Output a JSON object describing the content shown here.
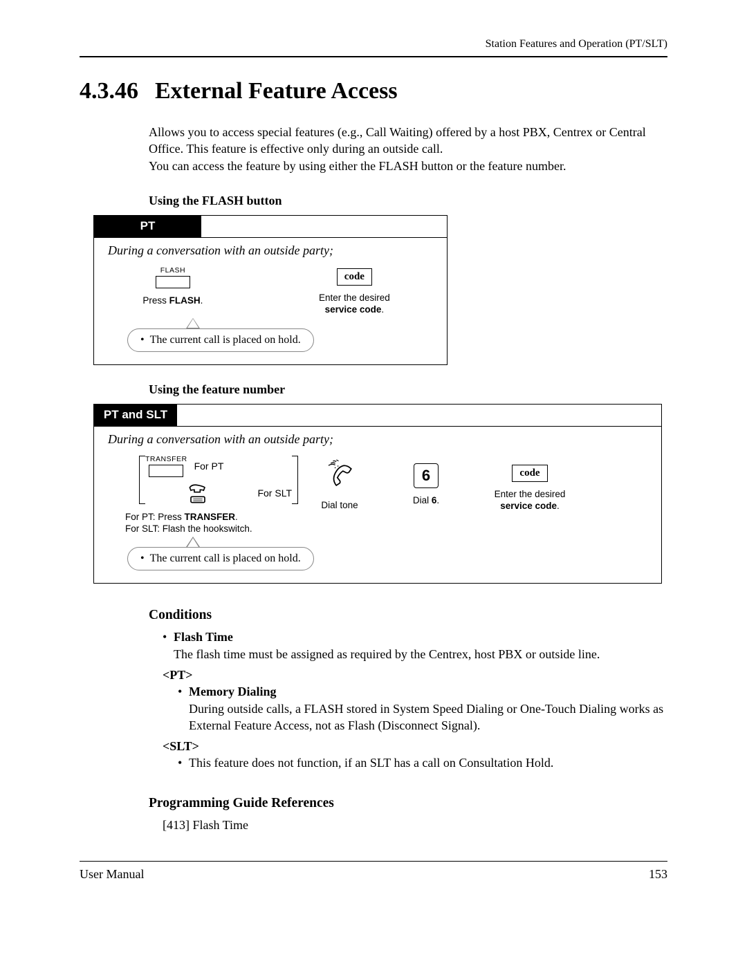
{
  "running_head": "Station Features and Operation (PT/SLT)",
  "section_number": "4.3.46",
  "section_title": "External Feature Access",
  "intro_p1": "Allows you to access special features (e.g., Call Waiting) offered by a host PBX, Centrex or Central Office. This feature is effective only during an outside call.",
  "intro_p2": "You can access the feature by using either the FLASH button or the feature number.",
  "proc1": {
    "heading": "Using the FLASH button",
    "tab": "PT",
    "caption": "During a conversation with an outside party;",
    "flash_label": "FLASH",
    "step1_text_a": "Press ",
    "step1_text_b": "FLASH",
    "step1_text_c": ".",
    "code_label": "code",
    "step2_text_a": "Enter the desired",
    "step2_text_b": "service code",
    "step2_text_c": ".",
    "note": "The current call is placed on hold."
  },
  "proc2": {
    "heading": "Using the feature number",
    "tab": "PT and SLT",
    "caption": "During a conversation with an outside party;",
    "transfer_label": "TRANSFER",
    "for_pt": "For PT",
    "for_slt": "For SLT",
    "step1_line1_a": "For PT: Press ",
    "step1_line1_b": "TRANSFER",
    "step1_line1_c": ".",
    "step1_line2": "For SLT: Flash the hookswitch.",
    "dial_tone": "Dial tone",
    "digit": "6",
    "dial6_a": "Dial ",
    "dial6_b": "6",
    "dial6_c": ".",
    "code_label": "code",
    "step4_text_a": "Enter the desired",
    "step4_text_b": "service code",
    "step4_text_c": ".",
    "note": "The current call is placed on hold."
  },
  "conditions": {
    "heading": "Conditions",
    "flash_time_label": "Flash Time",
    "flash_time_text": "The flash time must be assigned as required by the Centrex, host PBX or outside line.",
    "pt_label": "<PT>",
    "memory_label": "Memory Dialing",
    "memory_text": "During outside calls, a FLASH stored in System Speed Dialing or One-Touch Dialing works as External Feature Access, not as Flash (Disconnect Signal).",
    "slt_label": "<SLT>",
    "slt_text": "This feature does not function, if an SLT has a call on Consultation Hold."
  },
  "prog_refs": {
    "heading": "Programming Guide References",
    "item": "[413] Flash Time"
  },
  "footer_left": "User Manual",
  "footer_right": "153"
}
